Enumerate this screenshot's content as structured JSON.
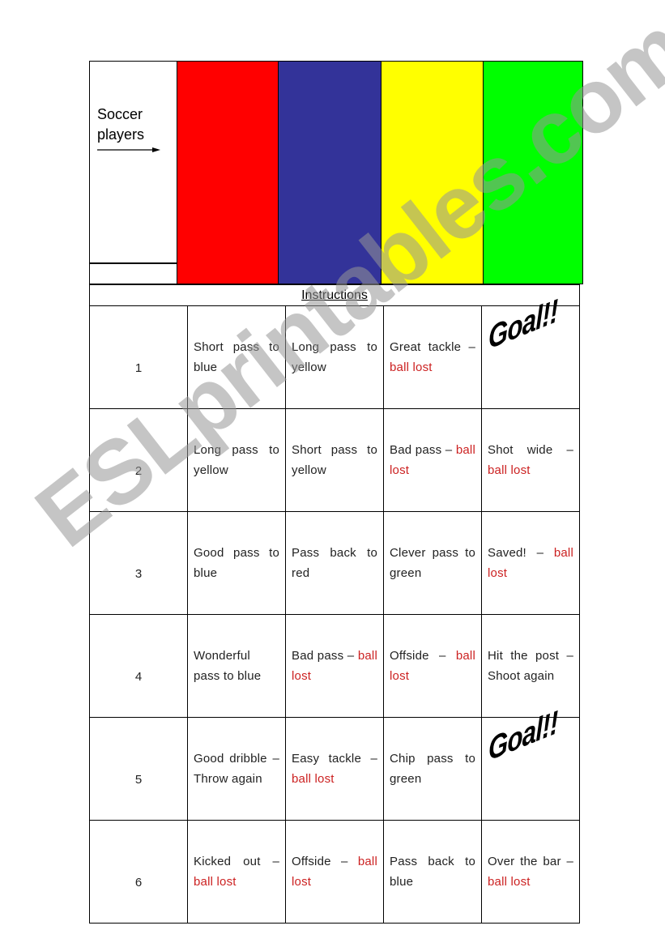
{
  "header": {
    "label_line1": "Soccer",
    "label_line2": "players",
    "arrow_icon": "right-arrow-icon"
  },
  "players": [
    {
      "name": "red",
      "color": "#ff0000"
    },
    {
      "name": "blue",
      "color": "#333399"
    },
    {
      "name": "yellow",
      "color": "#ffff00"
    },
    {
      "name": "green",
      "color": "#00ff00"
    }
  ],
  "instructions": {
    "title": "Instructions",
    "lost_color": "#cc2222",
    "rows": [
      {
        "number": "1",
        "cells": [
          {
            "text": "Short pass to blue",
            "lost": ""
          },
          {
            "text": "Long pass to yellow",
            "lost": ""
          },
          {
            "text": "Great tackle – ",
            "lost": "ball lost"
          },
          {
            "goal": "Goal!!"
          }
        ]
      },
      {
        "number": "2",
        "cells": [
          {
            "text": "Long pass to yellow",
            "lost": ""
          },
          {
            "text": "Short pass to yellow",
            "lost": ""
          },
          {
            "text": "Bad pass – ",
            "lost": "ball lost"
          },
          {
            "text": "Shot wide – ",
            "lost": "ball lost"
          }
        ]
      },
      {
        "number": "3",
        "cells": [
          {
            "text": "Good pass to blue",
            "lost": ""
          },
          {
            "text": "Pass back to red",
            "lost": ""
          },
          {
            "text": "Clever pass to green",
            "lost": ""
          },
          {
            "text": "Saved! – ",
            "lost": "ball lost"
          }
        ]
      },
      {
        "number": "4",
        "cells": [
          {
            "text": "Wonderful pass to blue",
            "lost": ""
          },
          {
            "text": "Bad pass – ",
            "lost": "ball lost"
          },
          {
            "text": "Offside – ",
            "lost": "ball lost"
          },
          {
            "text": "Hit the post – Shoot again",
            "lost": ""
          }
        ]
      },
      {
        "number": "5",
        "cells": [
          {
            "text": "Good dribble –Throw again",
            "lost": ""
          },
          {
            "text": "Easy tackle – ",
            "lost": "ball lost"
          },
          {
            "text": "Chip pass to green",
            "lost": ""
          },
          {
            "goal": "Goal!!"
          }
        ]
      },
      {
        "number": "6",
        "cells": [
          {
            "text": "Kicked out – ",
            "lost": "ball lost"
          },
          {
            "text": "Offside – ",
            "lost": "ball lost"
          },
          {
            "text": "Pass back to blue",
            "lost": ""
          },
          {
            "text": "Over the bar – ",
            "lost": "ball lost"
          }
        ]
      }
    ]
  },
  "watermark": "ESLprintables.com"
}
